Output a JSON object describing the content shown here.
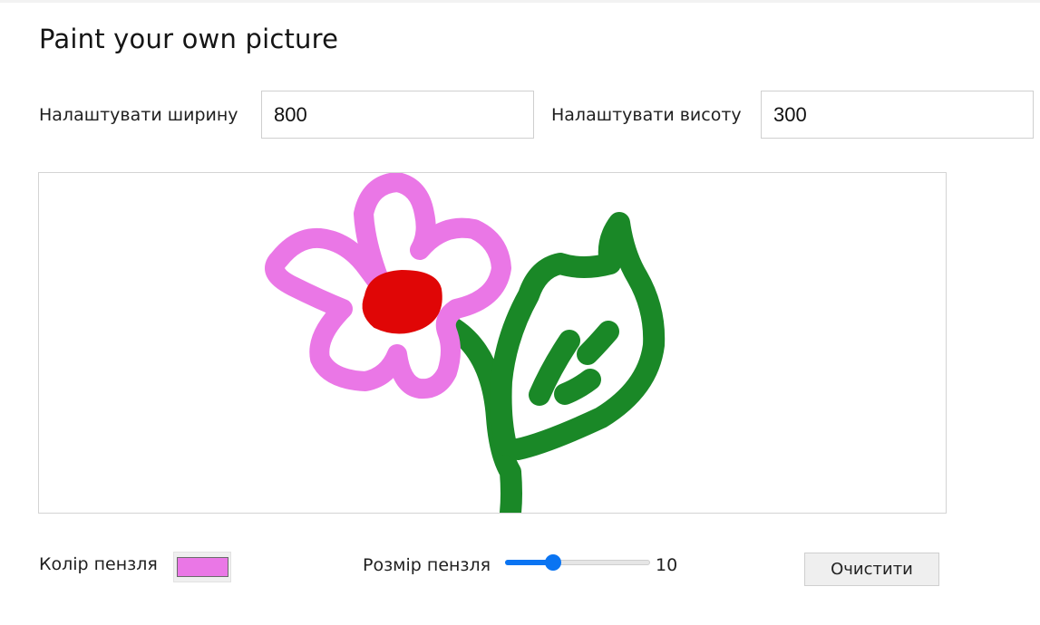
{
  "page": {
    "title": "Paint your own picture"
  },
  "size_controls": {
    "width_label": "Налаштувати ширину",
    "width_value": "800",
    "height_label": "Налаштувати висоту",
    "height_value": "300"
  },
  "drawing": {
    "petal_color": "#ea77e6",
    "center_color": "#e00606",
    "stem_color": "#1a8827"
  },
  "brush": {
    "color_label": "Колір пензля",
    "color_value": "#ea77e6",
    "size_label": "Розмір пензля",
    "size_value": "10",
    "size_min": 1,
    "size_max": 50,
    "size_number": 10
  },
  "actions": {
    "clear_label": "Очистити"
  }
}
